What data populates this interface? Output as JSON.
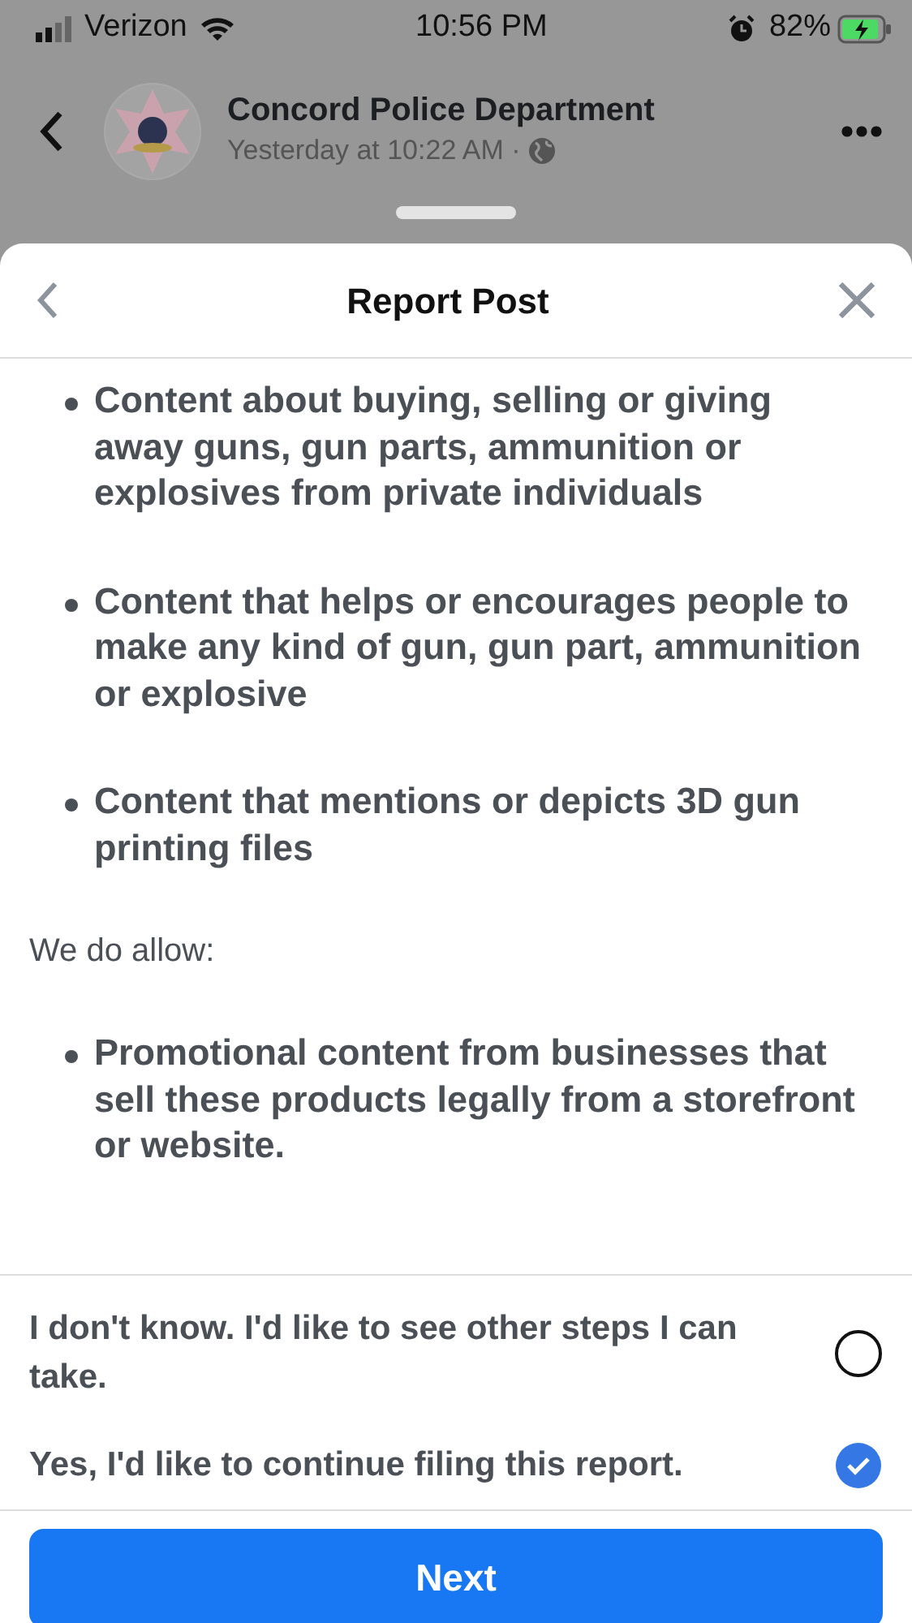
{
  "status_bar": {
    "carrier": "Verizon",
    "time": "10:56 PM",
    "battery": "82%"
  },
  "post": {
    "page_name": "Concord Police Department",
    "timestamp": "Yesterday at 10:22 AM ·"
  },
  "sheet": {
    "title": "Report Post",
    "prohibited": [
      "Content about buying, selling or giving away guns, gun parts, ammunition or explosives from private individuals",
      "Content that helps or encourages people to make any kind of gun, gun part, ammunition or explosive",
      "Content that mentions or depicts 3D gun printing files"
    ],
    "allow_label": "We do allow:",
    "allowed": [
      "Promotional content from businesses that sell these products legally from a storefront or website."
    ],
    "options": [
      {
        "label": "I don't know. I'd like to see other steps I can take.",
        "selected": false
      },
      {
        "label": "Yes, I'd like to continue filing this report.",
        "selected": true
      }
    ],
    "button": "Next"
  }
}
